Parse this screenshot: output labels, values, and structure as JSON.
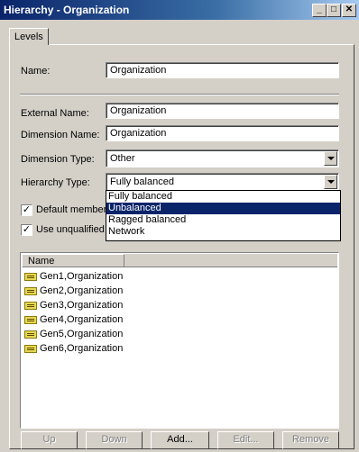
{
  "window": {
    "title": "Hierarchy - Organization",
    "controls": {
      "minimize": "_",
      "maximize": "□",
      "close": "✕"
    }
  },
  "tabs": [
    {
      "label": "Levels"
    }
  ],
  "form": {
    "name_label": "Name:",
    "name_value": "Organization",
    "external_name_label": "External Name:",
    "external_name_value": "Organization",
    "dimension_name_label": "Dimension Name:",
    "dimension_name_value": "Organization",
    "dimension_type_label": "Dimension Type:",
    "dimension_type_value": "Other",
    "hierarchy_type_label": "Hierarchy Type:",
    "hierarchy_type_value": "Fully balanced",
    "hierarchy_type_options": [
      "Fully balanced",
      "Unbalanced",
      "Ragged balanced",
      "Network"
    ],
    "hierarchy_type_highlighted": "Unbalanced",
    "default_member_label": "Default member",
    "default_member_checked": true,
    "use_unqualified_label": "Use unqualified",
    "use_unqualified_checked": true
  },
  "levels_list": {
    "column_header": "Name",
    "items": [
      "Gen1,Organization",
      "Gen2,Organization",
      "Gen3,Organization",
      "Gen4,Organization",
      "Gen5,Organization",
      "Gen6,Organization"
    ],
    "item_icon": "level-icon"
  },
  "buttons": {
    "up": "Up",
    "down": "Down",
    "add": "Add...",
    "edit": "Edit...",
    "remove": "Remove"
  },
  "colors": {
    "title_bar": "#0a246a",
    "selection": "#0a246a",
    "face": "#d4d0c8"
  }
}
